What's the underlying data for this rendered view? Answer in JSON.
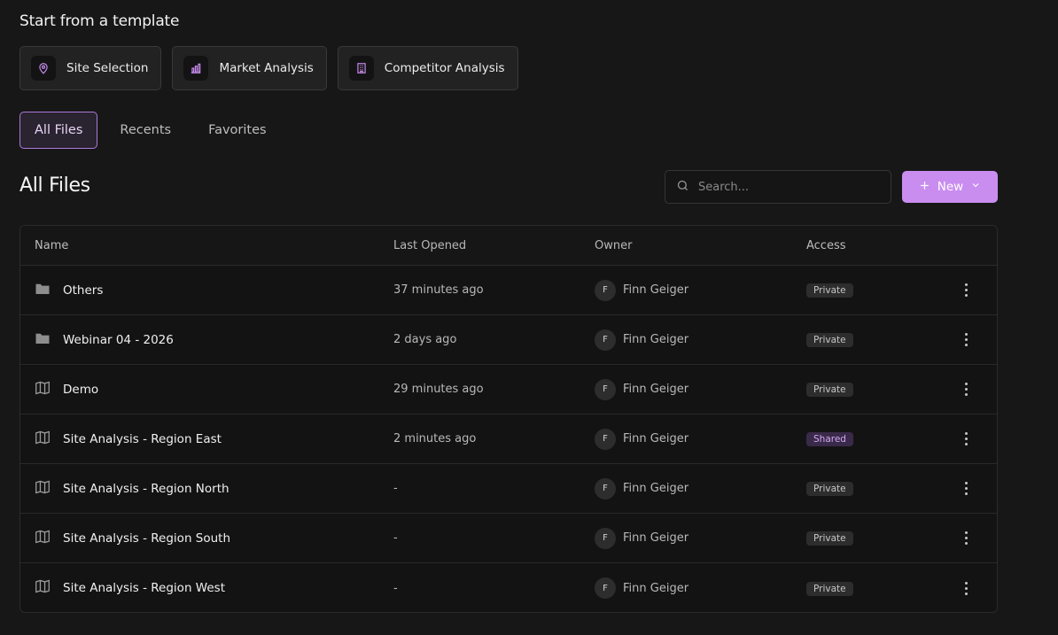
{
  "templates": {
    "title": "Start from a template",
    "cards": [
      {
        "label": "Site Selection",
        "icon": "location-pin-icon"
      },
      {
        "label": "Market Analysis",
        "icon": "bar-chart-icon"
      },
      {
        "label": "Competitor Analysis",
        "icon": "building-icon"
      }
    ]
  },
  "tabs": [
    {
      "label": "All Files",
      "active": true
    },
    {
      "label": "Recents",
      "active": false
    },
    {
      "label": "Favorites",
      "active": false
    }
  ],
  "section_title": "All Files",
  "search": {
    "placeholder": "Search...",
    "icon": "search-icon"
  },
  "new_button": {
    "label": "New",
    "icon_left": "plus-icon",
    "icon_right": "chevron-down-icon"
  },
  "table": {
    "headers": {
      "name": "Name",
      "last_opened": "Last Opened",
      "owner": "Owner",
      "access": "Access"
    },
    "rows": [
      {
        "type": "folder",
        "name": "Others",
        "last_opened": "37 minutes ago",
        "owner_initial": "F",
        "owner": "Finn Geiger",
        "access": "Private"
      },
      {
        "type": "folder",
        "name": "Webinar 04 - 2026",
        "last_opened": "2 days ago",
        "owner_initial": "F",
        "owner": "Finn Geiger",
        "access": "Private"
      },
      {
        "type": "map",
        "name": "Demo",
        "last_opened": "29 minutes ago",
        "owner_initial": "F",
        "owner": "Finn Geiger",
        "access": "Private"
      },
      {
        "type": "map",
        "name": "Site Analysis - Region East",
        "last_opened": "2 minutes ago",
        "owner_initial": "F",
        "owner": "Finn Geiger",
        "access": "Shared"
      },
      {
        "type": "map",
        "name": "Site Analysis - Region North",
        "last_opened": "-",
        "owner_initial": "F",
        "owner": "Finn Geiger",
        "access": "Private"
      },
      {
        "type": "map",
        "name": "Site Analysis - Region South",
        "last_opened": "-",
        "owner_initial": "F",
        "owner": "Finn Geiger",
        "access": "Private"
      },
      {
        "type": "map",
        "name": "Site Analysis - Region West",
        "last_opened": "-",
        "owner_initial": "F",
        "owner": "Finn Geiger",
        "access": "Private"
      }
    ]
  },
  "colors": {
    "background": "#181718",
    "accent": "#c98df0",
    "active_tab_border": "#a97bd8",
    "shared_badge": "#3a2a4a"
  }
}
